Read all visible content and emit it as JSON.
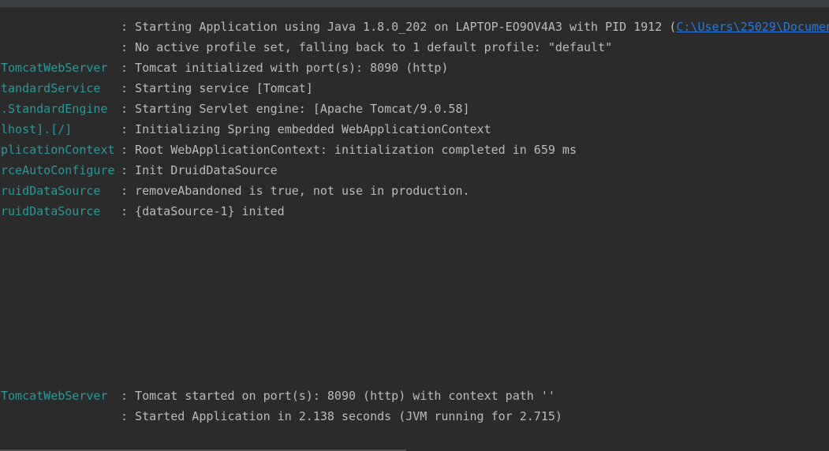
{
  "console": {
    "lines": [
      {
        "logger": "",
        "message": ": Starting Application using Java 1.8.0_202 on LAPTOP-EO9OV4A3 with PID 1912 (",
        "link": "C:\\Users\\25029\\Documen"
      },
      {
        "logger": "",
        "message": ": No active profile set, falling back to 1 default profile: \"default\""
      },
      {
        "logger": "TomcatWebServer",
        "message": ": Tomcat initialized with port(s): 8090 (http)"
      },
      {
        "logger": "tandardService",
        "message": ": Starting service [Tomcat]"
      },
      {
        "logger": ".StandardEngine",
        "message": ": Starting Servlet engine: [Apache Tomcat/9.0.58]"
      },
      {
        "logger": "lhost].[/]",
        "message": ": Initializing Spring embedded WebApplicationContext"
      },
      {
        "logger": "plicationContext",
        "message": ": Root WebApplicationContext: initialization completed in 659 ms"
      },
      {
        "logger": "rceAutoConfigure",
        "message": ": Init DruidDataSource"
      },
      {
        "logger": "ruidDataSource",
        "message": ": removeAbandoned is true, not use in production."
      },
      {
        "logger": "ruidDataSource",
        "message": ": {dataSource-1} inited"
      },
      {
        "logger": "TomcatWebServer",
        "message": ": Tomcat started on port(s): 8090 (http) with context path ''"
      },
      {
        "logger": "",
        "message": ": Started Application in 2.138 seconds (JVM running for 2.715)"
      }
    ]
  },
  "colors": {
    "background": "#2b2b2b",
    "logger": "#299999",
    "message": "#bbbbbb",
    "link": "#287bde"
  }
}
